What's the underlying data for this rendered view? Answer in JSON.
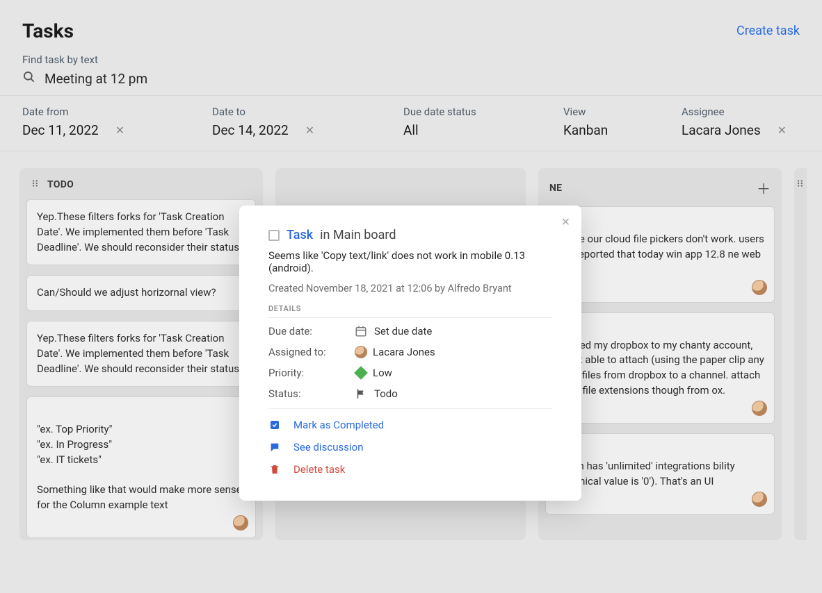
{
  "header": {
    "title": "Tasks",
    "create_label": "Create task"
  },
  "search": {
    "label": "Find task by text",
    "value": "Meeting at 12 pm"
  },
  "filters": {
    "date_from": {
      "label": "Date from",
      "value": "Dec 11, 2022"
    },
    "date_to": {
      "label": "Date to",
      "value": "Dec 14, 2022"
    },
    "due": {
      "label": "Due date status",
      "value": "All"
    },
    "view": {
      "label": "View",
      "value": "Kanban"
    },
    "assignee": {
      "label": "Assignee",
      "value": "Lacara Jones"
    }
  },
  "columns": {
    "left": {
      "title": "TODO",
      "cards": [
        {
          "text": "Yep.These filters forks for 'Task Creation Date'. We implemented them before 'Task Deadline'. We should reconsider their status."
        },
        {
          "text": "Can/Should we adjust horizornal view?"
        },
        {
          "text": "Yep.These filters forks for 'Task Creation Date'. We implemented them before 'Task Deadline'. We should reconsider their status."
        },
        {
          "text": "\"ex. Top Priority\"\n\"ex. In Progress\"\n\"ex. IT tickets\"\n\nSomething like that would make more sense for the Column example text",
          "avatar": true
        }
      ]
    },
    "right": {
      "title_suffix": "NE",
      "cards": [
        {
          "text": "ks like our cloud file pickers don't work. users has reported that today win app 12.8 ne web one",
          "avatar": true
        },
        {
          "text": "e linked my dropbox to my chanty account, m not able to attach (using the paper clip any .mp4 files from dropbox to a channel. attach other file extensions though from ox.",
          "avatar": true
        },
        {
          "text": "o plan has 'unlimited' integrations bility (technical value is '0'). That's an UI",
          "avatar": true
        }
      ]
    }
  },
  "modal": {
    "task_label": "Task",
    "location": "in Main board",
    "description": "Seems like 'Copy text/link' does not work in mobile 0.13 (android).",
    "created": "Created November 18, 2021 at 12:06 by Alfredo Bryant",
    "details_label": "DETAILS",
    "due_date": {
      "key": "Due date:",
      "value": "Set due date"
    },
    "assigned": {
      "key": "Assigned to:",
      "value": "Lacara Jones"
    },
    "priority": {
      "key": "Priority:",
      "value": "Low"
    },
    "status": {
      "key": "Status:",
      "value": "Todo"
    },
    "actions": {
      "complete": "Mark as Completed",
      "discussion": "See discussion",
      "delete": "Delete task"
    }
  }
}
